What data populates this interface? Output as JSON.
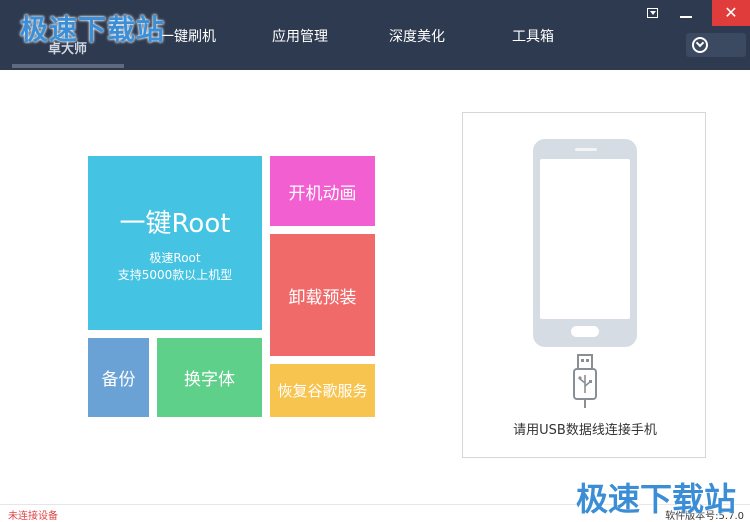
{
  "brand": {
    "watermark_top": "极速下载站"
  },
  "nav": {
    "home_label": "卓大师",
    "tabs": [
      {
        "label": "一键刷机"
      },
      {
        "label": "应用管理"
      },
      {
        "label": "深度美化"
      },
      {
        "label": "工具箱"
      }
    ]
  },
  "window_controls": {
    "close_glyph": "✕"
  },
  "tiles": {
    "root": {
      "title": "一键Root",
      "sub1": "极速Root",
      "sub2": "支持5000款以上机型"
    },
    "boot_animation": "开机动画",
    "uninstall_preinstalled": "卸载预装",
    "backup": "备份",
    "change_font": "换字体",
    "restore_google": "恢复谷歌服务"
  },
  "device_panel": {
    "hint": "请用USB数据线连接手机"
  },
  "status": {
    "left": "未连接设备",
    "version": "软件版本号:5.7.0"
  },
  "watermark_bottom": "极速下载站",
  "colors": {
    "titlebar": "#2e3a4f",
    "root_tile": "#44c3e2",
    "boot_tile": "#f15fd0",
    "uninstall_tile": "#f06a6a",
    "backup_tile": "#6aa2d6",
    "font_tile": "#5ed089",
    "google_tile": "#f8c450",
    "close_button": "#e03c3c"
  },
  "icons": [
    "menu-dropdown-icon",
    "minimize-icon",
    "close-icon",
    "download-icon",
    "phone-icon",
    "usb-cable-icon"
  ]
}
